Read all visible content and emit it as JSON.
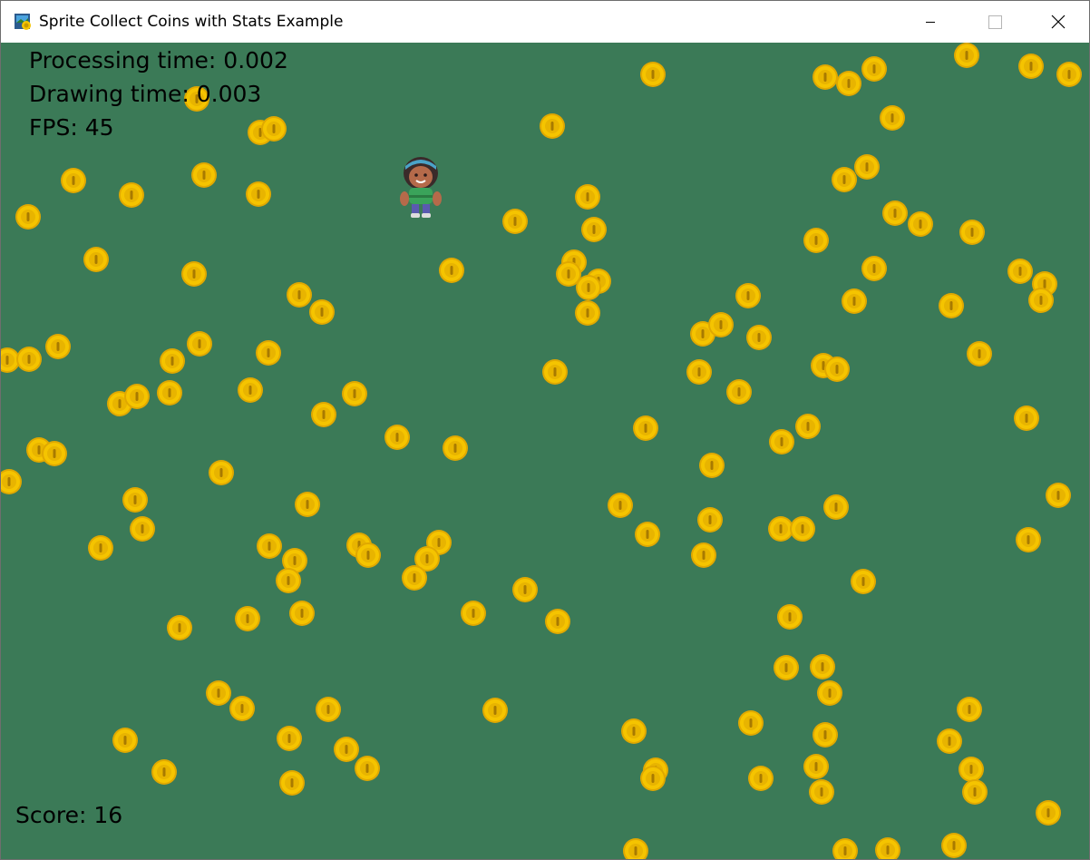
{
  "window": {
    "title": "Sprite Collect Coins with Stats Example",
    "controls": [
      "minimize",
      "maximize",
      "close"
    ],
    "icon": "python-arcade-icon"
  },
  "game": {
    "background_color": "#3b7a57",
    "stats": {
      "processing": "Processing time: 0.002",
      "drawing": "Drawing time: 0.003",
      "fps": "FPS: 45"
    },
    "score": "Score: 16",
    "player": {
      "sprite": "female-character-sprite"
    },
    "coin": {
      "sprite": "gold-coin-icon",
      "color": "#f5c400"
    }
  }
}
